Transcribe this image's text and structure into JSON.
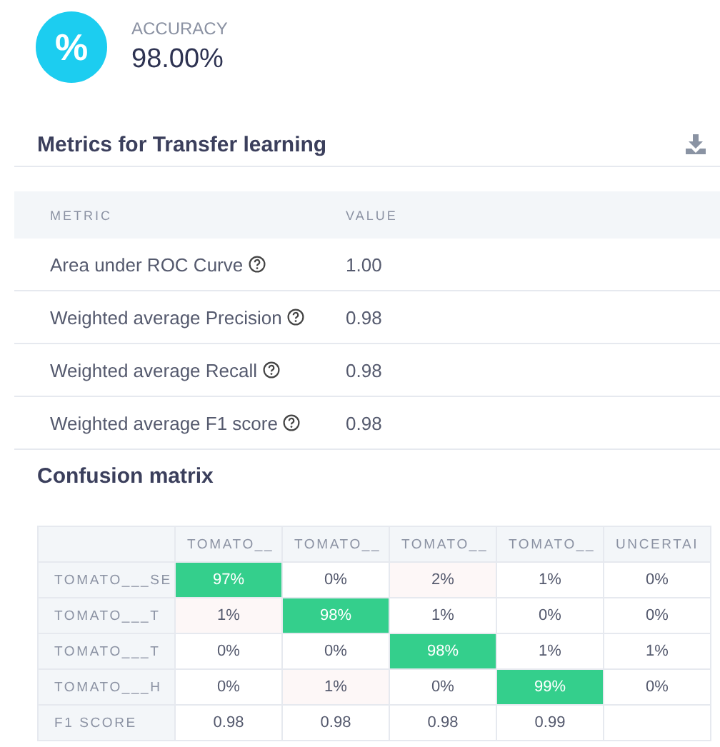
{
  "accuracy": {
    "icon": "%",
    "label": "ACCURACY",
    "value": "98.00%"
  },
  "metrics": {
    "title": "Metrics for Transfer learning",
    "columns": [
      "METRIC",
      "VALUE"
    ],
    "rows": [
      {
        "name": "Area under ROC Curve",
        "value": "1.00"
      },
      {
        "name": "Weighted average Precision",
        "value": "0.98"
      },
      {
        "name": "Weighted average Recall",
        "value": "0.98"
      },
      {
        "name": "Weighted average F1 score",
        "value": "0.98"
      }
    ]
  },
  "confusion_matrix": {
    "title": "Confusion matrix",
    "columns": [
      "TOMATO__",
      "TOMATO__",
      "TOMATO__",
      "TOMATO__",
      "UNCERTAI"
    ],
    "rows": [
      {
        "label": "TOMATO___SE",
        "cells": [
          {
            "value": "97%",
            "kind": "correct"
          },
          {
            "value": "0%",
            "kind": "plain"
          },
          {
            "value": "2%",
            "kind": "error"
          },
          {
            "value": "1%",
            "kind": "plain"
          },
          {
            "value": "0%",
            "kind": "plain"
          }
        ]
      },
      {
        "label": "TOMATO___T",
        "cells": [
          {
            "value": "1%",
            "kind": "error"
          },
          {
            "value": "98%",
            "kind": "correct"
          },
          {
            "value": "1%",
            "kind": "plain"
          },
          {
            "value": "0%",
            "kind": "plain"
          },
          {
            "value": "0%",
            "kind": "plain"
          }
        ]
      },
      {
        "label": "TOMATO___T",
        "cells": [
          {
            "value": "0%",
            "kind": "plain"
          },
          {
            "value": "0%",
            "kind": "plain"
          },
          {
            "value": "98%",
            "kind": "correct"
          },
          {
            "value": "1%",
            "kind": "plain"
          },
          {
            "value": "1%",
            "kind": "plain"
          }
        ]
      },
      {
        "label": "TOMATO___H",
        "cells": [
          {
            "value": "0%",
            "kind": "plain"
          },
          {
            "value": "1%",
            "kind": "error"
          },
          {
            "value": "0%",
            "kind": "plain"
          },
          {
            "value": "99%",
            "kind": "correct"
          },
          {
            "value": "0%",
            "kind": "plain"
          }
        ]
      }
    ],
    "footer": {
      "label": "F1 SCORE",
      "values": [
        "0.98",
        "0.98",
        "0.98",
        "0.99"
      ]
    }
  }
}
